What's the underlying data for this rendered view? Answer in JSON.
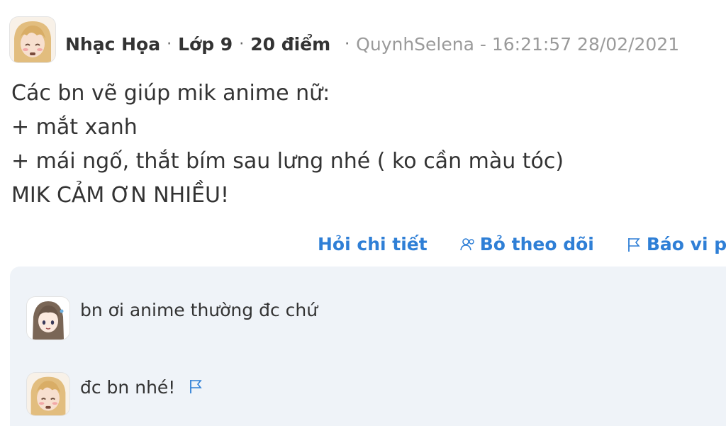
{
  "question": {
    "author_name": "Nhạc Họa",
    "grade": "Lớp 9",
    "points": "20 điểm",
    "meta": "QuynhSelena - 16:21:57 28/02/2021",
    "lines": [
      "Các bn vẽ giúp mik anime nữ:",
      "+ mắt xanh",
      "+ mái ngố, thắt bím sau lưng nhé ( ko cần màu tóc)",
      "MIK CẢM ƠN NHIỀU!"
    ]
  },
  "actions": {
    "ask_detail": "Hỏi chi tiết",
    "unfollow": "Bỏ theo dõi",
    "report": "Báo vi ph"
  },
  "comments": [
    {
      "text": "bn ơi anime thường đc chứ",
      "avatar": "anime-girl-avatar"
    },
    {
      "text": "đc bn nhé!",
      "avatar": "blonde-girl-avatar"
    }
  ],
  "colors": {
    "link": "#2f7fd6",
    "meta": "#9a9a9a",
    "comment_bg": "#eff3f8"
  }
}
